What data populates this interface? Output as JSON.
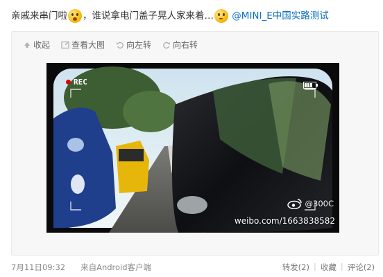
{
  "post": {
    "text_part1": "亲戚来串门啦",
    "text_part2": "，谁说拿电门盖子晃人家来着…",
    "mention": "@MINI_E中国实路测试"
  },
  "toolbar": {
    "collapse": "收起",
    "view_large": "查看大图",
    "rotate_left": "向左转",
    "rotate_right": "向右转"
  },
  "photo": {
    "rec_label": "REC",
    "watermark_handle": "@300C",
    "watermark_url": "weibo.com/1663838582"
  },
  "footer": {
    "time": "7月11日09:32",
    "source": "来自Android客户端",
    "repost": "转发(2)",
    "favorite": "收藏",
    "comment": "评论(2)"
  },
  "colors": {
    "mention": "#0a6ec4",
    "rec_dot": "#e00000"
  }
}
